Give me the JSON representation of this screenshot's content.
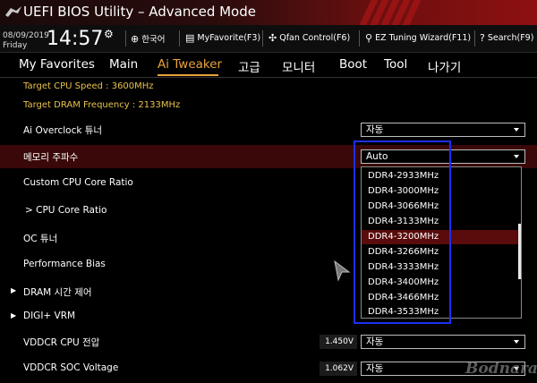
{
  "window": {
    "title": "UEFI BIOS Utility – Advanced Mode"
  },
  "infobar": {
    "date": "08/09/2019",
    "day": "Friday",
    "time": "14:57",
    "language": "한국어",
    "myfavorite": "MyFavorite(F3)",
    "qfan": "Qfan Control(F6)",
    "eztuning": "EZ Tuning Wizard(F11)",
    "search": "Search(F9)"
  },
  "nav": {
    "tabs": [
      "My Favorites",
      "Main",
      "Ai Tweaker",
      "고급",
      "모니터",
      "Boot",
      "Tool",
      "나가기"
    ],
    "active": "Ai Tweaker"
  },
  "content": {
    "target_cpu": "Target CPU Speed : 3600MHz",
    "target_dram": "Target DRAM Frequency : 2133MHz",
    "rows": [
      {
        "label": "Ai Overclock 튜너",
        "value": "자동"
      },
      {
        "label": "메모리 주파수",
        "value": "Auto"
      },
      {
        "label": "Custom CPU Core Ratio"
      },
      {
        "label": "> CPU Core Ratio"
      },
      {
        "label": "OC 튜너"
      },
      {
        "label": "Performance Bias"
      },
      {
        "label": "DRAM 시간 제어"
      },
      {
        "label": "DIGI+ VRM"
      },
      {
        "label": "VDDCR CPU 전압",
        "volt": "1.450V",
        "value": "자동"
      },
      {
        "label": "VDDCR SOC Voltage",
        "volt": "1.062V",
        "value": "자동"
      }
    ]
  },
  "dropdown": {
    "options": [
      "DDR4-2933MHz",
      "DDR4-3000MHz",
      "DDR4-3066MHz",
      "DDR4-3133MHz",
      "DDR4-3200MHz",
      "DDR4-3266MHz",
      "DDR4-3333MHz",
      "DDR4-3400MHz",
      "DDR4-3466MHz",
      "DDR4-3533MHz"
    ],
    "selected": "DDR4-3200MHz"
  },
  "watermark": "Bodnara",
  "colors": {
    "accent": "#e8a23a",
    "info_text": "#e8c24a",
    "title_red": "#8e1010",
    "highlight": "#3a0808",
    "annotation_box": "#1d2ff0"
  }
}
